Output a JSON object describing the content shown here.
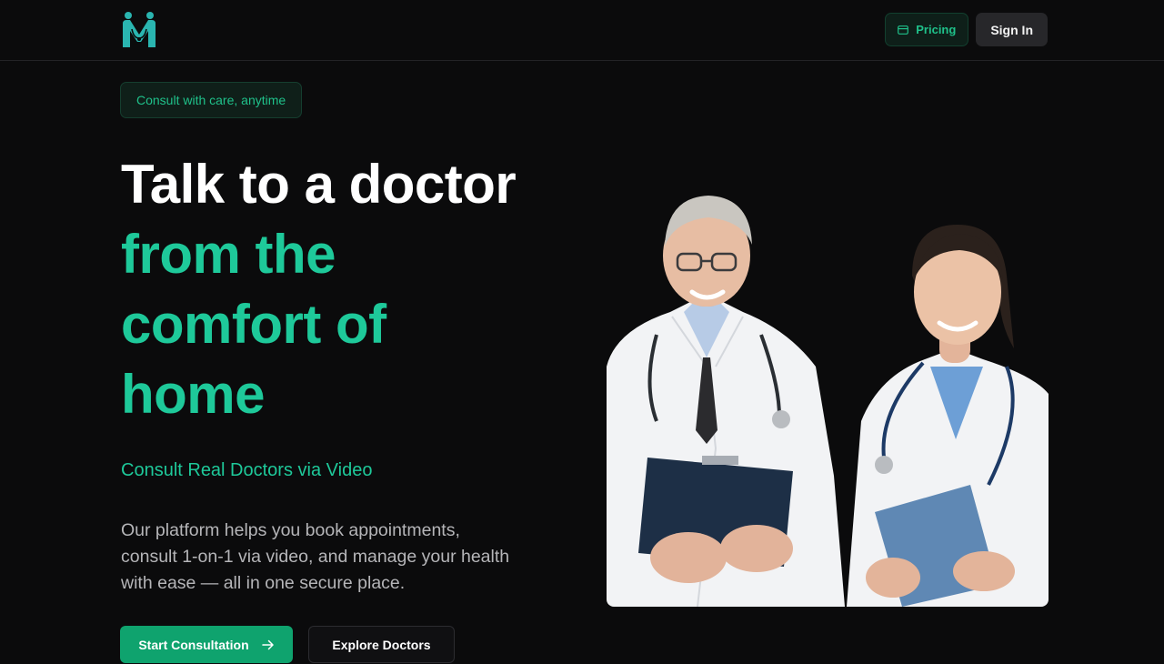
{
  "header": {
    "logo_icon": "medical-m-logo",
    "pricing_label": "Pricing",
    "signin_label": "Sign In"
  },
  "page_progress": 0.2,
  "hero": {
    "badge": "Consult with care, anytime",
    "headline_line1": "Talk to a doctor",
    "headline_line2": "from the",
    "headline_line3": "comfort of",
    "headline_line4": "home",
    "subheading": "Consult Real Doctors via Video",
    "description": "Our platform helps you book appointments, consult 1-on-1 via video, and manage your health with ease — all in one secure place.",
    "cta_primary": "Start Consultation",
    "cta_secondary": "Explore Doctors",
    "image_icon": "two-doctors-photo"
  },
  "colors": {
    "background": "#0b0b0c",
    "accent": "#1ec99a",
    "primary_button": "#0fa36e"
  }
}
